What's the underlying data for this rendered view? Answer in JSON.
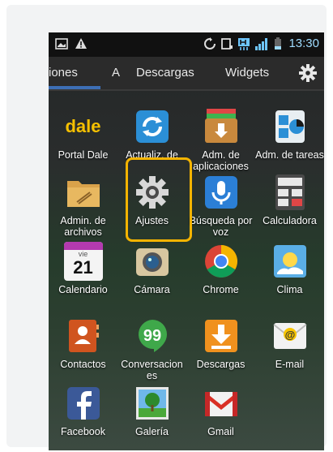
{
  "status": {
    "time": "13:30",
    "icons": [
      "screen-icon",
      "warning-icon",
      "sync-icon",
      "nfc-icon",
      "h-network-icon",
      "signal-icon",
      "battery-icon"
    ]
  },
  "tabs": [
    {
      "label": "iones",
      "active": true
    },
    {
      "label": "A"
    },
    {
      "label": "Descargas"
    },
    {
      "label": "Widgets"
    }
  ],
  "apps": [
    {
      "label": "Portal Dale",
      "text": "dale"
    },
    {
      "label": "Actualiz. de"
    },
    {
      "label": "Adm. de aplicaciones"
    },
    {
      "label": "Adm. de tareas"
    },
    {
      "label": "Admin. de archivos"
    },
    {
      "label": "Ajustes",
      "highlighted": true
    },
    {
      "label": "Búsqueda por voz"
    },
    {
      "label": "Calculadora"
    },
    {
      "label": "Calendario",
      "day_name": "vie",
      "day": "21"
    },
    {
      "label": "Cámara"
    },
    {
      "label": "Chrome"
    },
    {
      "label": "Clima"
    },
    {
      "label": "Contactos"
    },
    {
      "label": "Conversaciones"
    },
    {
      "label": "Descargas"
    },
    {
      "label": "E-mail"
    },
    {
      "label": "Facebook"
    },
    {
      "label": "Galería"
    },
    {
      "label": "Gmail"
    }
  ],
  "colors": {
    "highlight": "#f5b400",
    "tab_indicator": "#3d6fb5",
    "time": "#9fdcff"
  }
}
